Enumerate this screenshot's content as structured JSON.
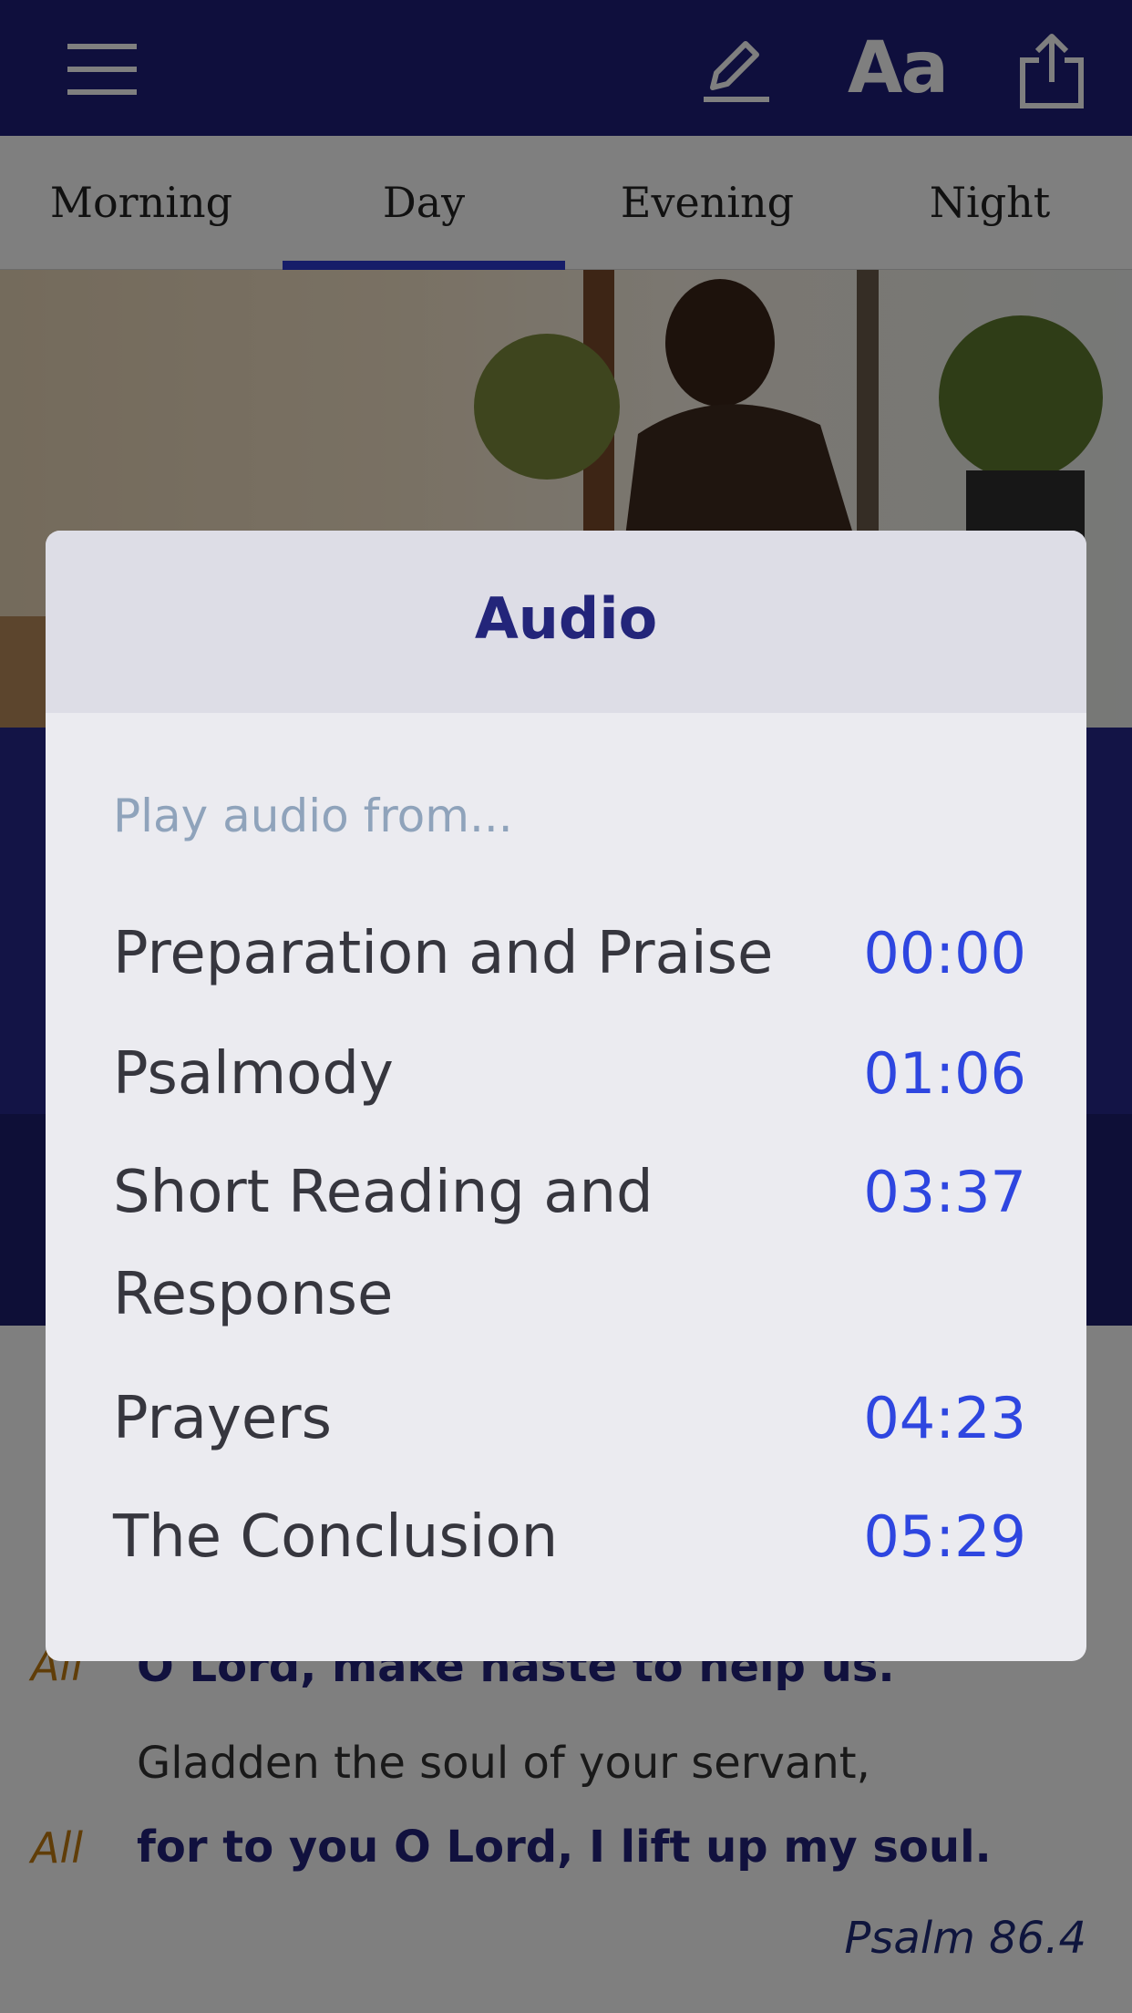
{
  "topbar": {
    "background": "#1e1f7a",
    "menu_icon": "menu-icon",
    "edit_icon": "pencil-icon",
    "font_size_label": "Aa",
    "share_icon": "share-icon"
  },
  "tabs": [
    {
      "label": "Morning",
      "selected": false
    },
    {
      "label": "Day",
      "selected": true
    },
    {
      "label": "Evening",
      "selected": false
    },
    {
      "label": "Night",
      "selected": false
    }
  ],
  "tab_accent": "#2d3bd3",
  "modal": {
    "title": "Audio",
    "subtitle": "Play audio from...",
    "items": [
      {
        "label": "Preparation and Praise",
        "time": "00:00"
      },
      {
        "label": "Psalmody",
        "time": "01:06"
      },
      {
        "label": "Short Reading and Response",
        "time": "03:37"
      },
      {
        "label": "Prayers",
        "time": "04:23"
      },
      {
        "label": "The Conclusion",
        "time": "05:29"
      }
    ],
    "time_color": "#2e46e0"
  },
  "background_content": {
    "all_label": "All",
    "verse_1": "O Lord, make haste to help us.",
    "verse_2": "Gladden the soul of your servant,",
    "verse_3": "for to you O Lord, I lift up my soul.",
    "citation": "Psalm 86.4"
  }
}
